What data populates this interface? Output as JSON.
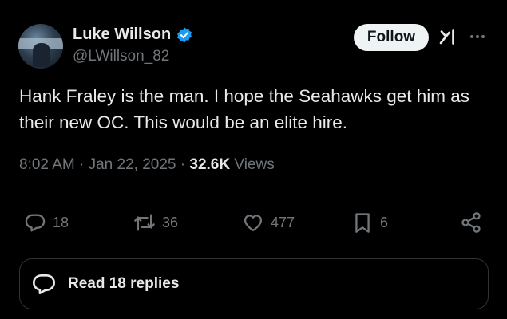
{
  "author": {
    "display_name": "Luke Willson",
    "handle": "@LWillson_82",
    "verified": true
  },
  "follow_button": {
    "label": "Follow"
  },
  "tweet": {
    "text": "Hank Fraley is the man. I hope the Seahawks get him as their new OC. This would be an elite hire."
  },
  "meta": {
    "time": "8:02 AM",
    "sep1": "·",
    "date": "Jan 22, 2025",
    "sep2": "·",
    "views_count": "32.6K",
    "views_label": "Views"
  },
  "actions": {
    "replies": "18",
    "reposts": "36",
    "likes": "477",
    "bookmarks": "6"
  },
  "read_replies": {
    "label": "Read 18 replies"
  },
  "icons": {
    "verified": "verified-badge-icon",
    "grok": "grok-icon",
    "more": "more-icon",
    "reply": "reply-icon",
    "repost": "repost-icon",
    "like": "heart-icon",
    "bookmark": "bookmark-icon",
    "share": "share-icon"
  },
  "colors": {
    "background": "#000000",
    "text": "#e7e9ea",
    "secondary": "#71767b",
    "verified": "#1d9bf0",
    "divider": "#2f3336",
    "follow_bg": "#eff3f4"
  }
}
